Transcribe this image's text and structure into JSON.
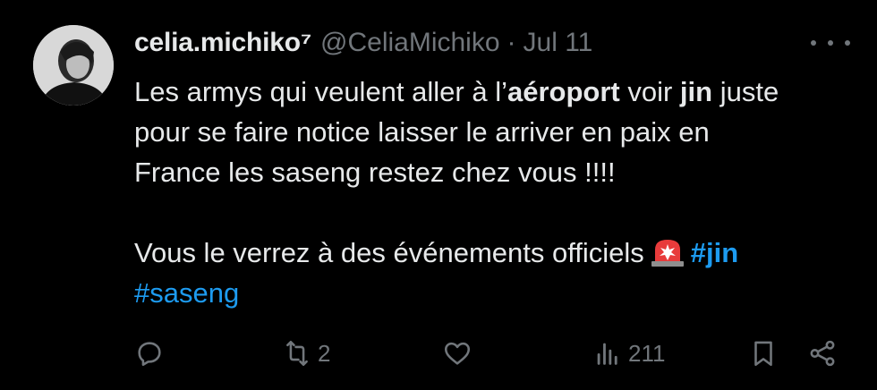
{
  "tweet": {
    "display_name": "celia.michiko⁷",
    "handle": "@CeliaMichiko",
    "separator": "·",
    "date": "Jul 11",
    "text": {
      "line1_a": "Les armys qui veulent aller à l’",
      "line1_b": "aéroport",
      "line1_c": " voir ",
      "line1_d": "jin",
      "line1_e": " juste",
      "line2": "pour se faire notice laisser le arriver en paix en",
      "line3": "France les saseng restez chez vous !!!!",
      "line5_a": "Vous le verrez à des événements officiels",
      "hashtag1": "#jin",
      "hashtag2": "#saseng"
    },
    "emoji": "rotating-light-emoji"
  },
  "actions": {
    "reply_count": "",
    "retweet_count": "2",
    "like_count": "",
    "views_count": "211"
  },
  "colors": {
    "background": "#000000",
    "text": "#e7e9ea",
    "muted": "#71767b",
    "link": "#1d9bf0"
  }
}
